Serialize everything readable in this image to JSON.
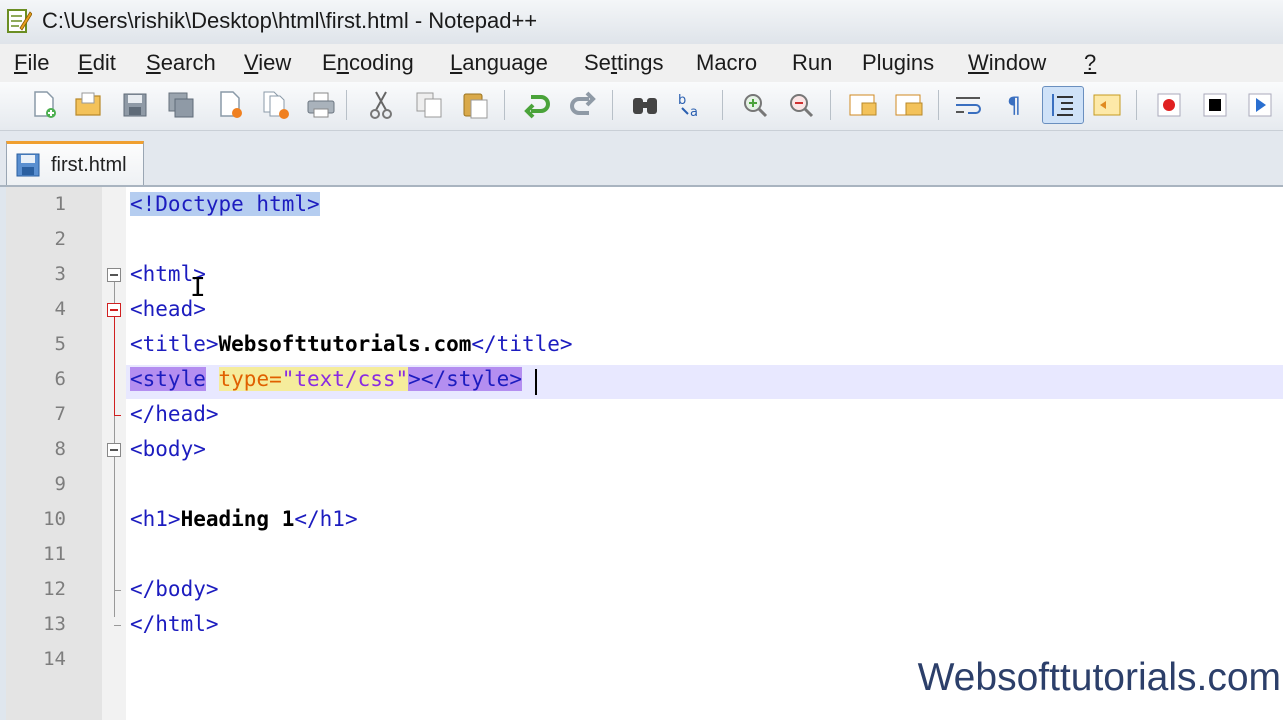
{
  "window": {
    "title": "C:\\Users\\rishik\\Desktop\\html\\first.html - Notepad++"
  },
  "menu": [
    {
      "pre": "",
      "u": "F",
      "post": "ile"
    },
    {
      "pre": "",
      "u": "E",
      "post": "dit"
    },
    {
      "pre": "",
      "u": "S",
      "post": "earch"
    },
    {
      "pre": "",
      "u": "V",
      "post": "iew"
    },
    {
      "pre": "E",
      "u": "n",
      "post": "coding"
    },
    {
      "pre": "",
      "u": "L",
      "post": "anguage"
    },
    {
      "pre": "Se",
      "u": "t",
      "post": "tings"
    },
    {
      "pre": "Macro",
      "u": "",
      "post": ""
    },
    {
      "pre": "Run",
      "u": "",
      "post": ""
    },
    {
      "pre": "Plugins",
      "u": "",
      "post": ""
    },
    {
      "pre": "",
      "u": "W",
      "post": "indow"
    },
    {
      "pre": "",
      "u": "?",
      "post": ""
    }
  ],
  "tab": {
    "label": "first.html"
  },
  "editor": {
    "line_numbers": [
      "1",
      "2",
      "3",
      "4",
      "5",
      "6",
      "7",
      "8",
      "9",
      "10",
      "11",
      "12",
      "13",
      "14"
    ],
    "line1": "<!Doctype html>",
    "line3": "<html>",
    "line4": "<head>",
    "line5_open": "<title>",
    "line5_text": "Websofttutorials.com",
    "line5_close": "</title>",
    "line6_tag": "<style",
    "line6_attr": "type=",
    "line6_val": "\"text/css\"",
    "line6_end": "></style>",
    "line7": "</head>",
    "line8": "<body>",
    "line10_open": "<h1>",
    "line10_text": "Heading 1",
    "line10_close": "</h1>",
    "line12": "</body>",
    "line13": "</html>"
  },
  "watermark": "Websofttutorials.com",
  "colors": {
    "tag": "#1c1cbf",
    "attribute": "#e06000",
    "value": "#8a2be2",
    "brace_highlight": "#b5cdf0",
    "tag_highlight": "#b48ef0"
  },
  "toolbar_icons": [
    "new-file-icon",
    "open-file-icon",
    "save-icon",
    "save-all-icon",
    "close-icon",
    "close-all-icon",
    "print-icon",
    "cut-icon",
    "copy-icon",
    "paste-icon",
    "undo-icon",
    "redo-icon",
    "find-icon",
    "replace-icon",
    "zoom-in-icon",
    "zoom-out-icon",
    "sync-vertical-icon",
    "sync-horizontal-icon",
    "word-wrap-icon",
    "show-all-chars-icon",
    "indent-guide-icon",
    "user-defined-lang-icon",
    "record-macro-icon",
    "stop-record-icon",
    "play-macro-icon"
  ]
}
